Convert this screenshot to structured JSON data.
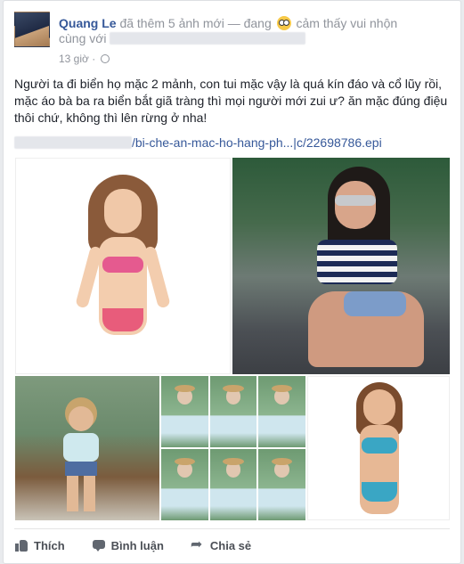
{
  "post": {
    "author": "Quang Le",
    "activity": "đã thêm 5 ảnh mới — đang",
    "feeling": "cảm thấy vui nhộn",
    "with_prefix": "cùng với",
    "timestamp": "13 giờ",
    "text": "Người ta đi biển họ mặc 2 mảnh, con tui mặc vậy là quá kín đáo và cổ lũy rồi, mặc áo bà ba ra biển bắt giã tràng thì mọi người mới zui ư? ăn mặc đúng điệu thôi chứ, không thì lên rừng ở nha!",
    "link_text": "/bi-che-an-mac-ho-hang-ph...|c/22698786.epi"
  },
  "actions": {
    "like": "Thích",
    "comment": "Bình luận",
    "share": "Chia sẻ"
  },
  "colors": {
    "link": "#365899",
    "meta": "#90949c",
    "text": "#1d2129"
  }
}
